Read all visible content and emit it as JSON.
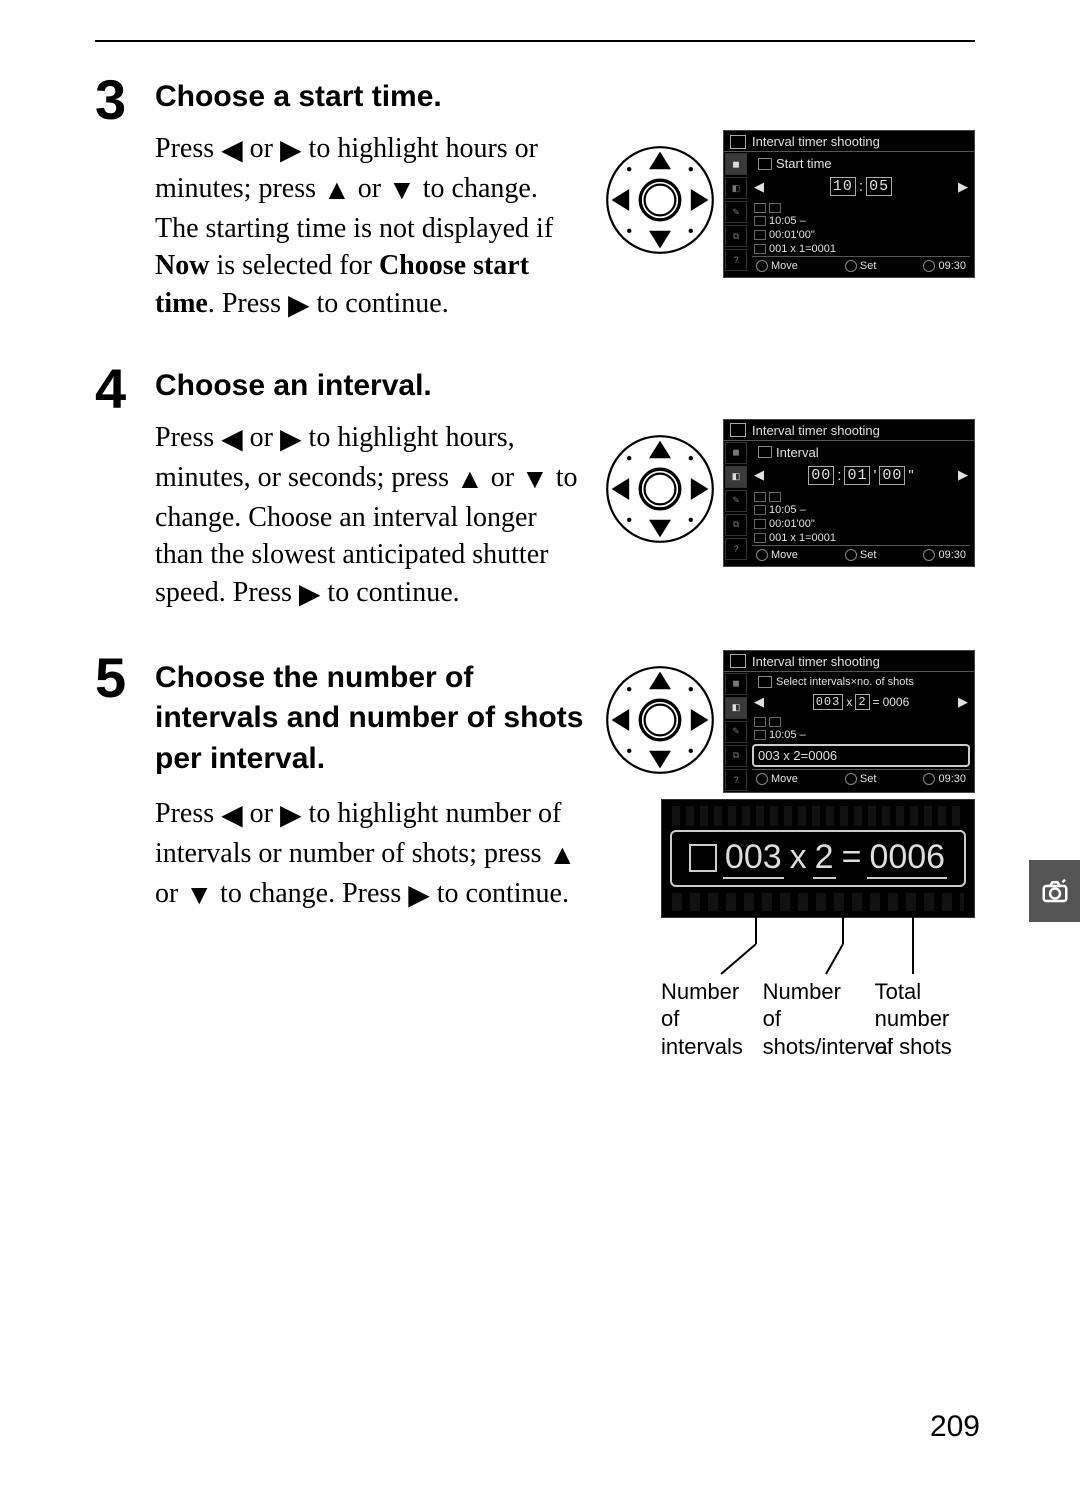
{
  "page_number": "209",
  "arrows": {
    "left": "◀",
    "right": "▶",
    "up": "▲",
    "down": "▼"
  },
  "steps": [
    {
      "num": "3",
      "heading": "Choose a start time.",
      "para_parts": [
        "Press ",
        " or ",
        " to highlight hours or minutes; press ",
        " or ",
        " to change.  The starting time is not displayed if ",
        "Now",
        " is selected for ",
        "Choose start time",
        ".  Press ",
        " to continue."
      ],
      "lcd": {
        "title": "Interval timer shooting",
        "subtitle": "Start time",
        "digits": [
          "10",
          ":",
          "05"
        ],
        "lines": [
          "10:05  –",
          "00:01'00\"",
          "001 x 1=0001"
        ],
        "foot": {
          "move": "Move",
          "set": "Set",
          "clock": "09:30"
        }
      }
    },
    {
      "num": "4",
      "heading": "Choose an interval.",
      "para_parts": [
        "Press ",
        " or ",
        " to highlight hours, minutes, or seconds; press ",
        " or ",
        " to change. Choose an interval longer than the slowest anticipated shutter speed.  Press ",
        " to continue."
      ],
      "lcd": {
        "title": "Interval timer shooting",
        "subtitle": "Interval",
        "digits": [
          "00",
          ":",
          "01",
          "'",
          "00",
          "\""
        ],
        "lines": [
          "10:05  –",
          "00:01'00\"",
          "001 x 1=0001"
        ],
        "foot": {
          "move": "Move",
          "set": "Set",
          "clock": "09:30"
        }
      }
    },
    {
      "num": "5",
      "heading": "Choose the number of intervals and number of shots per interval.",
      "para_parts": [
        "Press ",
        " or ",
        " to highlight number of intervals or number of shots; press ",
        " or ",
        " to change.  Press ",
        " to continue."
      ],
      "lcd": {
        "title": "Interval timer shooting",
        "subtitle": "Select intervals×no. of shots",
        "digits": [
          "003",
          "x",
          "2",
          "=",
          "0006"
        ],
        "lines": [
          "10:05  –"
        ],
        "hl": "003 x 2=0006",
        "foot": {
          "move": "Move",
          "set": "Set",
          "clock": "09:30"
        }
      },
      "zoom": {
        "intervals": "003",
        "op": "x",
        "shots": "2",
        "eq": "=",
        "total": "0006"
      },
      "callouts": {
        "c1": "Number of intervals",
        "c2": "Number of shots/interval",
        "c3": "Total number of shots"
      }
    }
  ]
}
